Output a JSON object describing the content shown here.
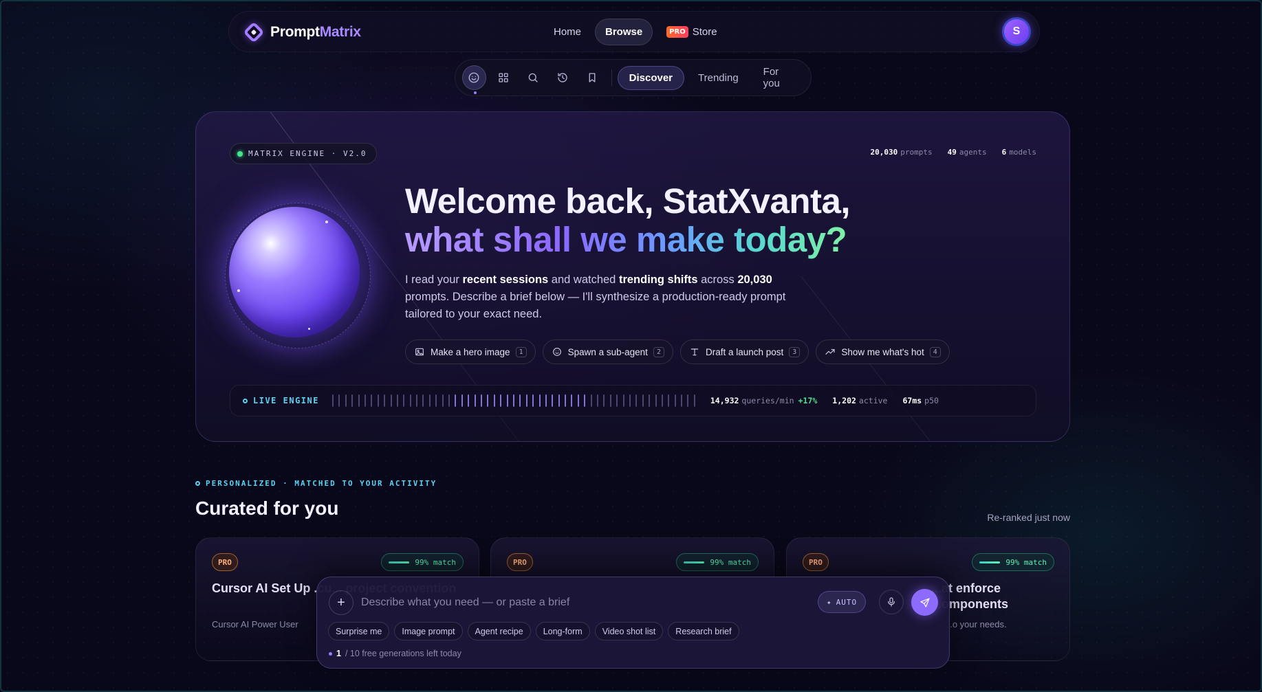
{
  "brand": {
    "name_part1": "Prompt",
    "name_part2": "Matrix"
  },
  "nav": {
    "links": [
      {
        "label": "Home",
        "active": false
      },
      {
        "label": "Browse",
        "active": true
      }
    ],
    "store": {
      "badge": "PRO",
      "label": "Store"
    },
    "avatar_initial": "S"
  },
  "subnav": {
    "icons": [
      "smile-icon",
      "grid-icon",
      "search-icon",
      "history-icon",
      "bookmark-icon"
    ],
    "tabs": [
      {
        "label": "Discover",
        "active": true
      },
      {
        "label": "Trending",
        "active": false
      },
      {
        "label": "For you",
        "active": false
      }
    ]
  },
  "hero": {
    "engine_chip": "MATRIX ENGINE · V2.0",
    "stats": [
      {
        "value": "20,030",
        "label": "prompts"
      },
      {
        "value": "49",
        "label": "agents"
      },
      {
        "value": "6",
        "label": "models"
      }
    ],
    "greeting": "Welcome back, StatXvanta,",
    "headline": "what shall we make today?",
    "lead": {
      "p1": "I read your ",
      "b1": "recent sessions",
      "p2": " and watched ",
      "b2": "trending shifts",
      "p3": " across ",
      "b3": "20,030",
      "p4": " prompts. Describe a brief below — I'll synthesize a production-ready prompt tailored to your exact need."
    },
    "suggestions": [
      {
        "icon": "image-icon",
        "label": "Make a hero image",
        "key": "1"
      },
      {
        "icon": "smile-icon",
        "label": "Spawn a sub-agent",
        "key": "2"
      },
      {
        "icon": "text-icon",
        "label": "Draft a launch post",
        "key": "3"
      },
      {
        "icon": "trending-icon",
        "label": "Show me what's hot",
        "key": "4"
      }
    ],
    "live": {
      "label": "LIVE ENGINE",
      "queries_value": "14,932",
      "queries_label": "queries/min",
      "queries_delta": "+17%",
      "active_value": "1,202",
      "active_label": "active",
      "latency_value": "67ms",
      "latency_label": "p50"
    }
  },
  "curated": {
    "kicker": "PERSONALIZED · MATCHED TO YOUR ACTIVITY",
    "title": "Curated for you",
    "reranked": "Re-ranked just now",
    "cards": [
      {
        "badge": "PRO",
        "match": "99% match",
        "title": "Cursor AI Set Up .cu... project convention",
        "subtitle": "Cursor AI Power User"
      },
      {
        "badge": "PRO",
        "match": "99% match",
        "title": "",
        "subtitle": ""
      },
      {
        "badge": "PRO",
        "match": "99% match",
        "title": "...at enforce ...omponents",
        "subtitle": "...o your needs."
      }
    ]
  },
  "composer": {
    "placeholder": "Describe what you need — or paste a brief",
    "auto_label": "AUTO",
    "quick_chips": [
      "Surprise me",
      "Image prompt",
      "Agent recipe",
      "Long-form",
      "Video shot list",
      "Research brief"
    ],
    "quota_used": "1",
    "quota_text": "/ 10 free generations left today"
  },
  "colors": {
    "accent": "#8e6bff",
    "live": "#5ad3f0",
    "success": "#46e58d",
    "pro": "#ffb07a"
  }
}
